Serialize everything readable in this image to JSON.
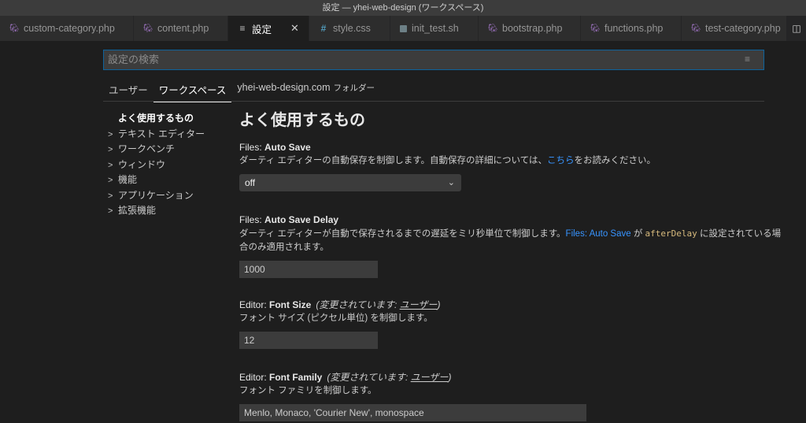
{
  "window": {
    "title": "設定 — yhei-web-design (ワークスペース)"
  },
  "tabs": [
    {
      "label": "custom-category.php",
      "icon": "php-icon"
    },
    {
      "label": "content.php",
      "icon": "php-icon"
    },
    {
      "label": "設定",
      "icon": "gear-icon",
      "active": true
    },
    {
      "label": "style.css",
      "icon": "css-icon"
    },
    {
      "label": "init_test.sh",
      "icon": "shell-icon"
    },
    {
      "label": "bootstrap.php",
      "icon": "php-icon"
    },
    {
      "label": "functions.php",
      "icon": "php-icon"
    },
    {
      "label": "test-category.php",
      "icon": "php-icon"
    }
  ],
  "tab_close_glyph": "✕",
  "search": {
    "placeholder": "設定の検索"
  },
  "scopes": {
    "user": "ユーザー",
    "workspace": "ワークスペース",
    "folder": "yhei-web-design.com",
    "folder_suffix": "フォルダー"
  },
  "toc": {
    "active": "よく使用するもの",
    "items": [
      "テキスト エディター",
      "ワークベンチ",
      "ウィンドウ",
      "機能",
      "アプリケーション",
      "拡張機能"
    ]
  },
  "section_title": "よく使用するもの",
  "settings": {
    "auto_save": {
      "category": "Files: ",
      "name": "Auto Save",
      "desc_pre": "ダーティ エディターの自動保存を制御します。自動保存の詳細については、",
      "desc_link": "こちら",
      "desc_post": "をお読みください。",
      "value": "off"
    },
    "auto_save_delay": {
      "category": "Files: ",
      "name": "Auto Save Delay",
      "desc_pre": "ダーティ エディターが自動で保存されるまでの遅延をミリ秒単位で制御します。",
      "desc_link": "Files: Auto Save",
      "desc_mid": " が ",
      "desc_code": "afterDelay",
      "desc_post": " に設定されている場合のみ適用されます。",
      "value": "1000"
    },
    "font_size": {
      "category": "Editor: ",
      "name": "Font Size",
      "modified_pre": "(変更されています: ",
      "modified_scope": "ユーザー",
      "modified_post": ")",
      "desc": "フォント サイズ (ピクセル単位) を制御します。",
      "value": "12"
    },
    "font_family": {
      "category": "Editor: ",
      "name": "Font Family",
      "modified_pre": "(変更されています: ",
      "modified_scope": "ユーザー",
      "modified_post": ")",
      "desc": "フォント ファミリを制御します。",
      "value": "Menlo, Monaco, 'Courier New', monospace"
    }
  }
}
